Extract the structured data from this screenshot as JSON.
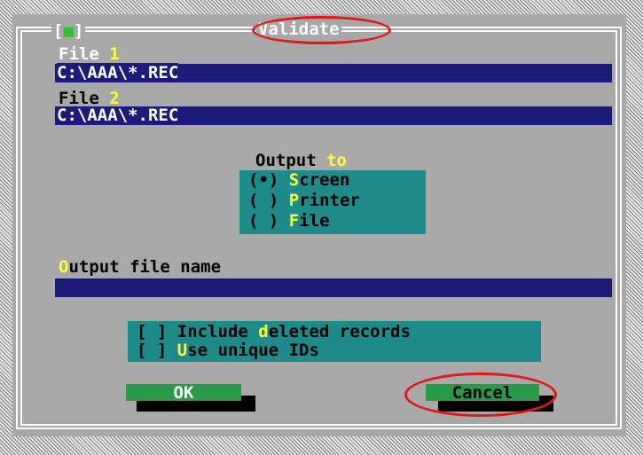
{
  "dialog": {
    "title_hotkey": "V",
    "title_rest": "alidate",
    "close_bracket_left": "[",
    "close_square": "■",
    "close_bracket_right": "]"
  },
  "file1": {
    "label": "File ",
    "hotkey": "1",
    "value": "C:\\AAA\\*.REC"
  },
  "file2": {
    "label": "File ",
    "hotkey": "2",
    "value": "C:\\AAA\\*.REC"
  },
  "output": {
    "label": "Output ",
    "label_hotkey": "to",
    "options": [
      {
        "mark": "(•) ",
        "hotkey": "S",
        "rest": "creen",
        "selected": true
      },
      {
        "mark": "( ) ",
        "hotkey": "P",
        "rest": "rinter",
        "selected": false
      },
      {
        "mark": "( ) ",
        "hotkey": "F",
        "rest": "ile",
        "selected": false
      }
    ]
  },
  "output_file": {
    "hotkey": "O",
    "label_rest": "utput file name",
    "value": ""
  },
  "checks": [
    {
      "mark": "[ ] ",
      "before": "Include ",
      "hotkey": "d",
      "after": "eleted records"
    },
    {
      "mark": "[ ] ",
      "before": "",
      "hotkey": "U",
      "after": "se unique IDs"
    }
  ],
  "buttons": {
    "ok_label": "OK",
    "cancel_label": "Cancel"
  },
  "colors": {
    "dialog_bg": "#a8a8a8",
    "field_bg": "#1c1c78",
    "group_bg": "#1e8a8a",
    "button_bg": "#2a9a48",
    "hotkey": "#ffff33",
    "annotation": "#e01818"
  }
}
